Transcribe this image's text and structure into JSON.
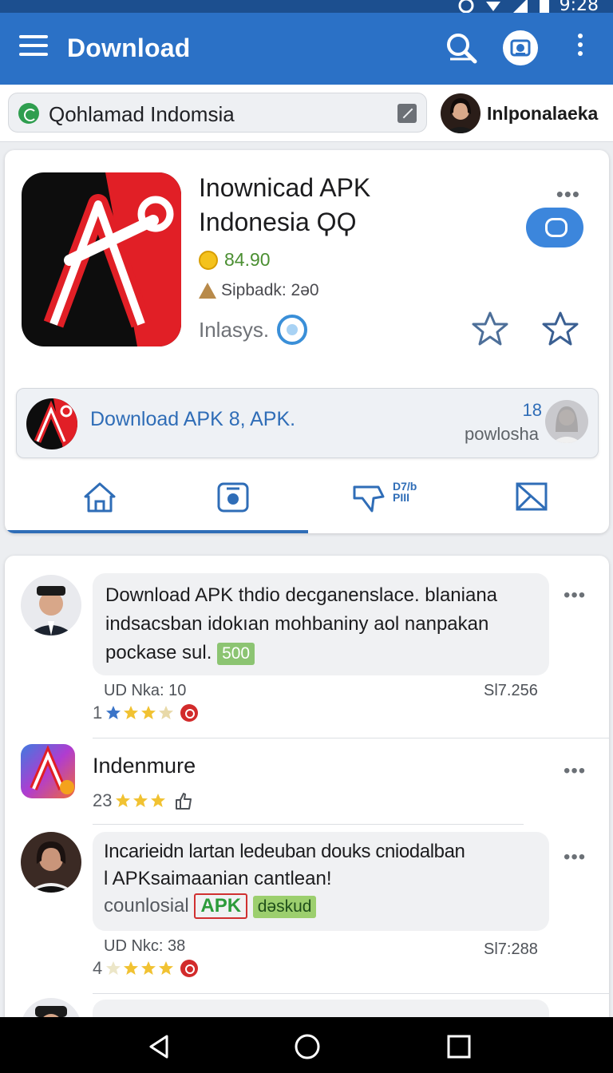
{
  "status_bar": {
    "time": "9:28"
  },
  "app_bar": {
    "title": "Download"
  },
  "search": {
    "value": "Qohlamad Indomsia"
  },
  "user": {
    "name": "Inlponalaeka"
  },
  "app_card": {
    "title_line1": "Inownicad APK",
    "title_line2": "Indonesia ϘϘ",
    "rating": "84.90",
    "size_label": "Sipbadk: 2ə0",
    "installs": "Inlasys.",
    "more": "•••"
  },
  "download_banner": {
    "label": "Download APK 8, APK.",
    "count": "18",
    "sub": "powlosha"
  },
  "tabs": {
    "like_badge": "D7/b\nPIII"
  },
  "feed": [
    {
      "text": "Download APK thdio decganenslace. blaniana indsacsban idokıan mohbaniny aol nanpakan pockase sul.",
      "tag": "500",
      "meta_left": "UD Nka:   10",
      "meta_right": "Sl7.256",
      "stars_num": "1",
      "more": "•••"
    },
    {
      "title": "Indenmure",
      "stars_num": "23",
      "more": "•••"
    },
    {
      "text_line1": "Incarieidn lartan ledeuban douks cniodalban",
      "text_line2": "l APKsaimaanian cantlean!",
      "text_line3": "counlosial",
      "tag_apk": "APK",
      "tag_green": "dəskud",
      "meta_left": "UD Nkc:   38",
      "meta_right": "Sl7:288",
      "stars_num": "4",
      "more": "•••"
    }
  ],
  "colors": {
    "primary": "#2b71c6",
    "accent_red": "#e11f26",
    "link_blue": "#2f6db7"
  }
}
